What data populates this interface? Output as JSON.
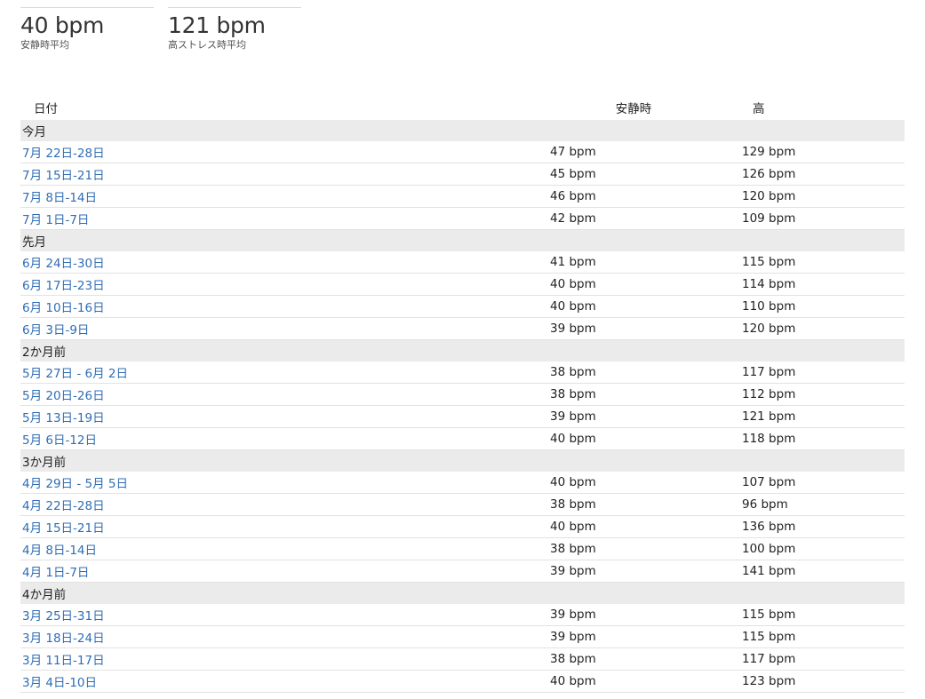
{
  "stats": [
    {
      "value": "40 bpm",
      "label": "安静時平均"
    },
    {
      "value": "121 bpm",
      "label": "高ストレス時平均"
    }
  ],
  "table": {
    "headers": {
      "date": "日付",
      "rest": "安静時",
      "high": "高"
    },
    "groups": [
      {
        "label": "今月",
        "rows": [
          {
            "date": "7月 22日-28日",
            "rest": "47 bpm",
            "high": "129 bpm"
          },
          {
            "date": "7月 15日-21日",
            "rest": "45 bpm",
            "high": "126 bpm"
          },
          {
            "date": "7月 8日-14日",
            "rest": "46 bpm",
            "high": "120 bpm"
          },
          {
            "date": "7月 1日-7日",
            "rest": "42 bpm",
            "high": "109 bpm"
          }
        ]
      },
      {
        "label": "先月",
        "rows": [
          {
            "date": "6月 24日-30日",
            "rest": "41 bpm",
            "high": "115 bpm"
          },
          {
            "date": "6月 17日-23日",
            "rest": "40 bpm",
            "high": "114 bpm"
          },
          {
            "date": "6月 10日-16日",
            "rest": "40 bpm",
            "high": "110 bpm"
          },
          {
            "date": "6月 3日-9日",
            "rest": "39 bpm",
            "high": "120 bpm"
          }
        ]
      },
      {
        "label": "2か月前",
        "rows": [
          {
            "date": "5月 27日 - 6月 2日",
            "rest": "38 bpm",
            "high": "117 bpm"
          },
          {
            "date": "5月 20日-26日",
            "rest": "38 bpm",
            "high": "112 bpm"
          },
          {
            "date": "5月 13日-19日",
            "rest": "39 bpm",
            "high": "121 bpm"
          },
          {
            "date": "5月 6日-12日",
            "rest": "40 bpm",
            "high": "118 bpm"
          }
        ]
      },
      {
        "label": "3か月前",
        "rows": [
          {
            "date": "4月 29日 - 5月 5日",
            "rest": "40 bpm",
            "high": "107 bpm"
          },
          {
            "date": "4月 22日-28日",
            "rest": "38 bpm",
            "high": "96 bpm"
          },
          {
            "date": "4月 15日-21日",
            "rest": "40 bpm",
            "high": "136 bpm"
          },
          {
            "date": "4月 8日-14日",
            "rest": "38 bpm",
            "high": "100 bpm"
          },
          {
            "date": "4月 1日-7日",
            "rest": "39 bpm",
            "high": "141 bpm"
          }
        ]
      },
      {
        "label": "4か月前",
        "rows": [
          {
            "date": "3月 25日-31日",
            "rest": "39 bpm",
            "high": "115 bpm"
          },
          {
            "date": "3月 18日-24日",
            "rest": "39 bpm",
            "high": "115 bpm"
          },
          {
            "date": "3月 11日-17日",
            "rest": "38 bpm",
            "high": "117 bpm"
          },
          {
            "date": "3月 4日-10日",
            "rest": "40 bpm",
            "high": "123 bpm"
          }
        ]
      }
    ]
  },
  "colors": {
    "link": "#2f6db5",
    "group_bg": "#ebebeb",
    "divider": "#e2e2e2"
  }
}
